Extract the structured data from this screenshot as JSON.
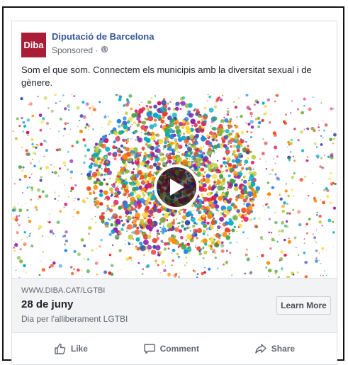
{
  "post": {
    "logo_text": "Diba",
    "page_name": "Diputació de Barcelona",
    "sponsored": "Sponsored ·",
    "caption": "Som el que som. Connectem els municipis amb la diversitat sexual i de gènere."
  },
  "media": {
    "palette": [
      "#e53935",
      "#fb8c00",
      "#fdd835",
      "#43a047",
      "#1e88e5",
      "#8e24aa",
      "#d81b60",
      "#00acc1",
      "#f4511e",
      "#7cb342",
      "#3949ab",
      "#c0ca33"
    ]
  },
  "link": {
    "domain": "WWW.DIBA.CAT/LGTBI",
    "headline": "28 de juny",
    "description": "Dia per l'alliberament LGTBI",
    "cta_label": "Learn More"
  },
  "actions": {
    "like": "Like",
    "comment": "Comment",
    "share": "Share"
  },
  "colors": {
    "brand": "#a91d37",
    "link_blue": "#365899"
  }
}
